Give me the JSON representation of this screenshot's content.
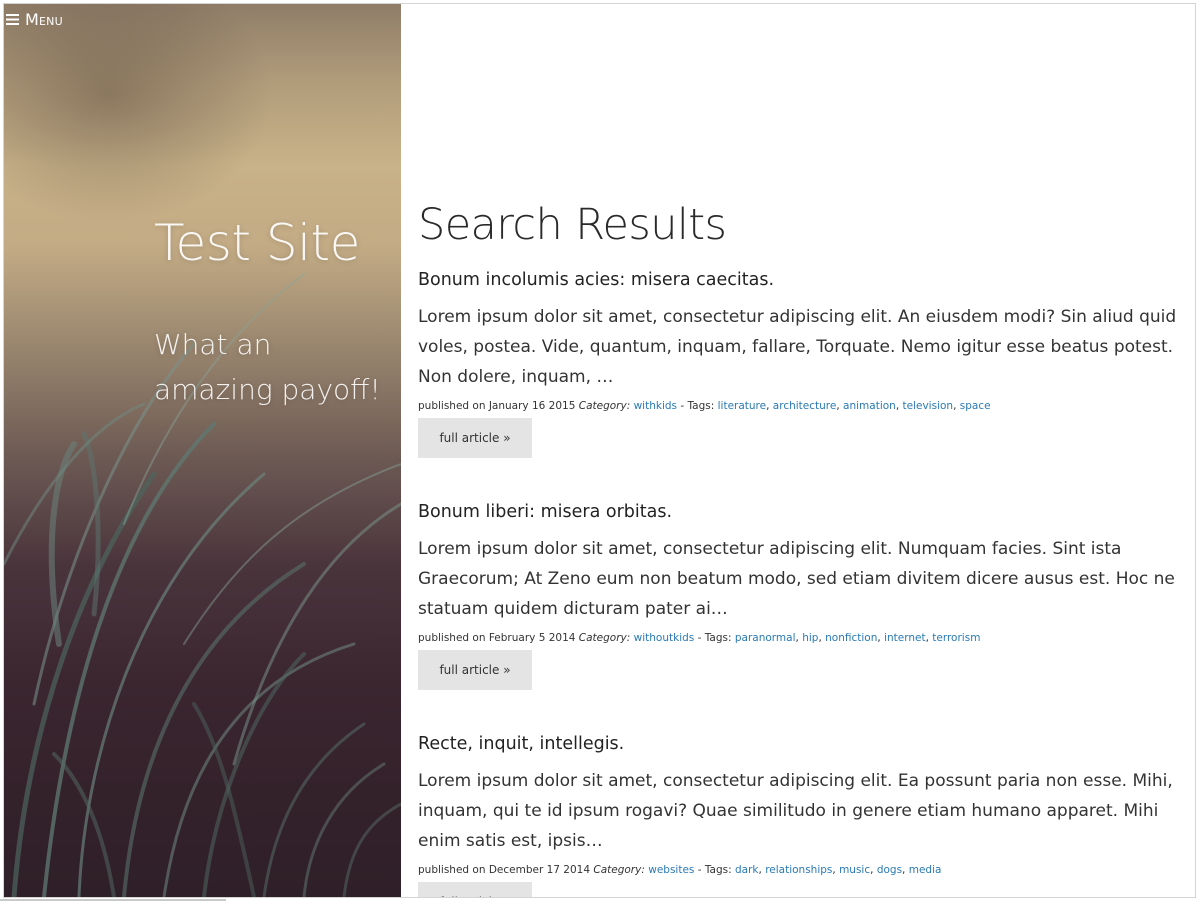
{
  "menu": {
    "label": "Menu",
    "icon": "hamburger-icon"
  },
  "hero": {
    "site_title": "Test Site",
    "tagline": "What an amazing payoff!"
  },
  "page": {
    "title": "Search Results"
  },
  "colors": {
    "link": "#2a7ab5",
    "button_bg": "#e4e4e4",
    "text": "#333333"
  },
  "articles": [
    {
      "title": "Bonum incolumis acies: misera caecitas.",
      "excerpt": "Lorem ipsum dolor sit amet, consectetur adipiscing elit. An eiusdem modi? Sin aliud quid voles, postea. Vide, quantum, inquam, fallare, Torquate. Nemo igitur esse beatus potest. Non dolere, inquam, …",
      "published_prefix": "published on January 16 2015",
      "category_label": "Category:",
      "category": "withkids",
      "tags_label": "- Tags:",
      "tags": [
        "literature",
        "architecture",
        "animation",
        "television",
        "space"
      ],
      "read_more": "full article »"
    },
    {
      "title": "Bonum liberi: misera orbitas.",
      "excerpt": "Lorem ipsum dolor sit amet, consectetur adipiscing elit. Numquam facies. Sint ista Graecorum; At Zeno eum non beatum modo, sed etiam divitem dicere ausus est. Hoc ne statuam quidem dicturam pater ai…",
      "published_prefix": "published on February 5 2014",
      "category_label": "Category:",
      "category": "withoutkids",
      "tags_label": "- Tags:",
      "tags": [
        "paranormal",
        "hip",
        "nonfiction",
        "internet",
        "terrorism"
      ],
      "read_more": "full article »"
    },
    {
      "title": "Recte, inquit, intellegis.",
      "excerpt": "Lorem ipsum dolor sit amet, consectetur adipiscing elit. Ea possunt paria non esse. Mihi, inquam, qui te id ipsum rogavi? Quae similitudo in genere etiam humano apparet. Mihi enim satis est, ipsis…",
      "published_prefix": "published on December 17 2014",
      "category_label": "Category:",
      "category": "websites",
      "tags_label": "- Tags:",
      "tags": [
        "dark",
        "relationships",
        "music",
        "dogs",
        "media"
      ],
      "read_more": "full article »"
    }
  ]
}
